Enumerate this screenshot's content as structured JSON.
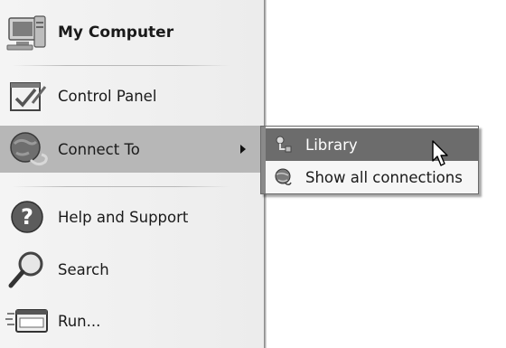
{
  "start_menu": {
    "items": [
      {
        "label": "My Computer",
        "icon": "my-computer-icon"
      },
      {
        "label": "Control Panel",
        "icon": "control-panel-icon"
      },
      {
        "label": "Connect To",
        "icon": "connect-to-icon",
        "has_submenu": true,
        "highlighted": true
      },
      {
        "label": "Help and Support",
        "icon": "help-icon"
      },
      {
        "label": "Search",
        "icon": "search-icon"
      },
      {
        "label": "Run...",
        "icon": "run-icon"
      }
    ]
  },
  "connect_to_submenu": {
    "items": [
      {
        "label": "Library",
        "icon": "network-connection-icon",
        "selected": true
      },
      {
        "label": "Show all connections",
        "icon": "network-globe-icon"
      }
    ]
  },
  "colors": {
    "highlight": "#b7b7b7",
    "selected": "#6c6c6c",
    "pane": "#f0f0f0"
  }
}
